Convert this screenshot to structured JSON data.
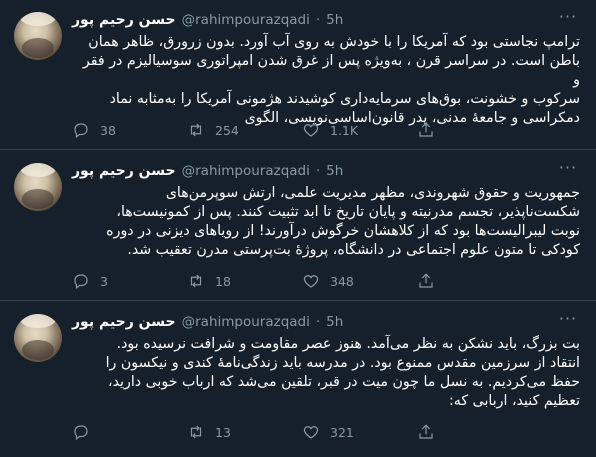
{
  "tweets": [
    {
      "name": "حسن رحیم پور",
      "handle": "@rahimpourazqadi",
      "dot": "·",
      "time": "5h",
      "more": "···",
      "text": "ترامپ نجاستی بود که آمریکا را با خودش به روی آب آورد. بدون زرورق، ظاهر همان\nباطن است. در سراسر قرن ، به‌ویژه پس از غرق شدن امپراتوری سوسیالیزم در فقر و\nسرکوب و خشونت، بوق‌های سرمایه‌داری کوشیدند هژمونی آمریکا را به‌مثابه نماد\nدمکراسی و جامعهٔ مدنی، پدر قانون‌اساسی‌نویسی، الگوی",
      "replies": "38",
      "retweets": "254",
      "likes": "1.1K"
    },
    {
      "name": "حسن رحیم پور",
      "handle": "@rahimpourazqadi",
      "dot": "·",
      "time": "5h",
      "more": "···",
      "text": "جمهوریت و حقوق شهروندی، مظهر مدیریت علمی، ارتش سوپرمن‌های\nشکست‌ناپذیر، تجسم مدرنیته و پایان تاریخ تا ابد تثبیت کنند. پس از کمونیست‌ها،\nنوبت لیبرالیست‌ها بود که از کلاهشان خرگوش درآورند! از رویاهای دیزنی در دوره\nکودکی تا متون علوم اجتماعی در دانشگاه، پروژهٔ بت‌پرستی مدرن تعقیب شد.",
      "replies": "3",
      "retweets": "18",
      "likes": "348"
    },
    {
      "name": "حسن رحیم پور",
      "handle": "@rahimpourazqadi",
      "dot": "·",
      "time": "5h",
      "more": "···",
      "text": "بت بزرگ، باید نشکن به نظر می‌آمد. هنوز عصر مقاومت و شرافت نرسیده بود.\nانتقاد از سرزمین مقدس ممنوع بود. در مدرسه باید زندگی‌نامهٔ کندی و نیکسون را\nحفظ می‌کردیم.  به نسل ما چون میت در قبر، تلقین می‌شد که ارباب خوبی دارید،\nتعظیم کنید، اربابی که:",
      "replies": "",
      "retweets": "13",
      "likes": "321"
    }
  ],
  "colors": {
    "background": "#15202b",
    "secondary_text": "#8899a6",
    "divider": "#38444d"
  },
  "icons": [
    "reply-icon",
    "retweet-icon",
    "like-icon",
    "share-icon",
    "more-icon"
  ]
}
